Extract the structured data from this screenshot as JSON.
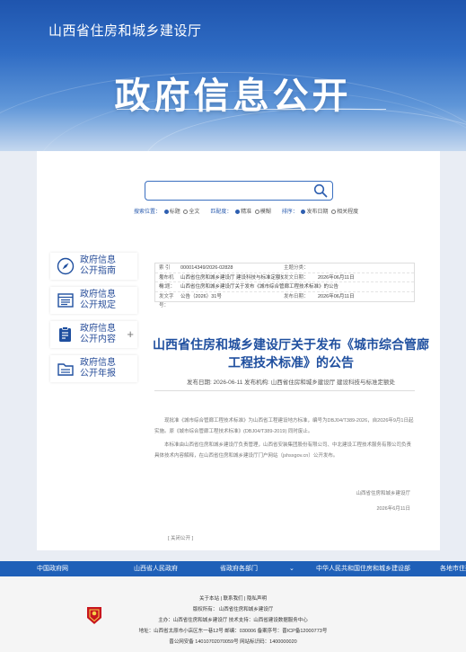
{
  "header": {
    "site_title": "山西省住房和城乡建设厅",
    "page_title": "政府信息公开"
  },
  "search": {
    "placeholder": "",
    "scope_label": "搜索位置：",
    "scope_options": [
      "标题",
      "全文"
    ],
    "match_label": "匹配度：",
    "match_options": [
      "精准",
      "模糊"
    ],
    "sort_label": "排序：",
    "sort_options": [
      "发布日期",
      "相关程度"
    ]
  },
  "menu": [
    {
      "label": "政府信息公开指南",
      "icon": "compass-icon"
    },
    {
      "label": "政府信息公开规定",
      "icon": "document-list-icon"
    },
    {
      "label": "政府信息公开内容",
      "icon": "clipboard-icon",
      "expand": "+"
    },
    {
      "label": "政府信息公开年报",
      "icon": "folder-icon"
    }
  ],
  "meta": {
    "index_label": "索 引 号：",
    "index_value": "000014349/2026-02828",
    "topic_label": "主题分类：",
    "topic_value": "",
    "org_label": "发布机构：",
    "org_value": "山西省住房和城乡建设厅 建设科技与标准定额处",
    "created_label": "发文日期：",
    "created_value": "2026年06月11日",
    "title_label": "标    题：",
    "title_value": "山西省住房和城乡建设厅关于发布《城市综合管廊工程技术标准》的公告",
    "docno_label": "发文字号：",
    "docno_value": "公告（2026）31号",
    "pubdate_label": "发布日期：",
    "pubdate_value": "2026年06月11日"
  },
  "article": {
    "title": "山西省住房和城乡建设厅关于发布《城市综合管廊工程技术标准》的公告",
    "info": "发布日期: 2026-06-11 发布机构: 山西省住房和城乡建设厅 建设科技与标准定额处",
    "p1": "现批准《城市综合管廊工程技术标准》为山西省工程建设地方标准，编号为DBJ04/T389-2026，自2026年9月1日起实施。原《城市综合管廊工程技术标准》(DBJ04/T389-2019) 同时废止。",
    "p2": "本标准由山西省住房和城乡建设厅负责管理，山西省安装集团股份有限公司、中北建设工程技术服务有限公司负责具体技术内容解释，在山西省住房和城乡建设厅门户网站（jshsxgov.cn）公开发布。",
    "sign_org": "山西省住房和城乡建设厅",
    "sign_date": "2026年6月11日",
    "close_label": "[ 关闭公开 ]"
  },
  "navbar": [
    "中国政府网",
    "山西省人民政府",
    "省政府各部门",
    "中华人民共和国住房和城乡建设部",
    "各地市住建"
  ],
  "navbar_arrow": "⌄",
  "footer": {
    "links": "关于本站   |   联系我们   |   隐私声明",
    "copyright": "版权所有：  山西省住房和城乡建设厅",
    "sponsor": "主办：山西省住房和城乡建设厅     技术支持：山西省建设数据服务中心",
    "address": "地址：山西省太原市小店区东一巷12号     邮编：030006     备案序号：晋ICP备12000773号",
    "police": "晋公网安备 14010702070059号        网站标识码：1400000020"
  },
  "colors": {
    "brand_blue": "#1f60b8",
    "title_blue": "#1f4f9f"
  }
}
